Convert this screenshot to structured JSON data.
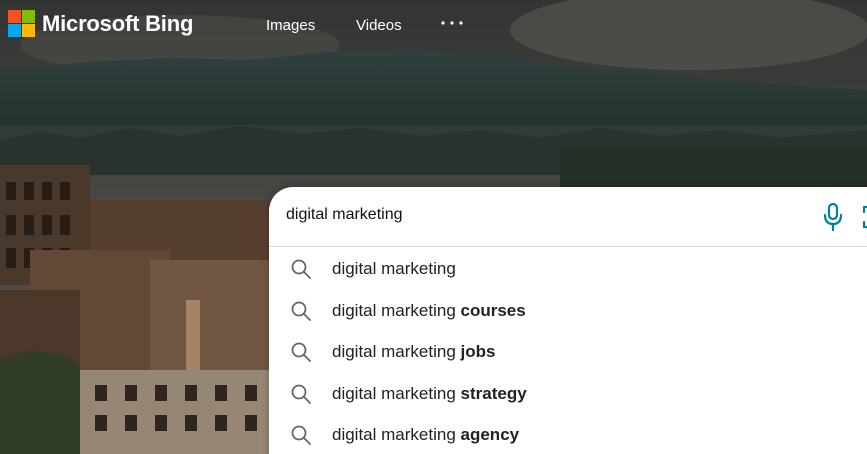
{
  "header": {
    "brand": "Microsoft Bing",
    "nav": [
      {
        "label": "Images"
      },
      {
        "label": "Videos"
      }
    ],
    "more_icon": "more-dots-icon",
    "logo_colors": [
      "#f35325",
      "#81bc06",
      "#05a6f0",
      "#ffba08"
    ]
  },
  "search": {
    "value": "digital marketing",
    "mic_icon": "microphone-icon",
    "visual_search_icon": "visual-search-icon",
    "accent_color": "#00809d"
  },
  "suggestions": [
    {
      "prefix": "digital marketing",
      "bold": ""
    },
    {
      "prefix": "digital marketing ",
      "bold": "courses"
    },
    {
      "prefix": "digital marketing ",
      "bold": "jobs"
    },
    {
      "prefix": "digital marketing ",
      "bold": "strategy"
    },
    {
      "prefix": "digital marketing ",
      "bold": "agency"
    }
  ]
}
